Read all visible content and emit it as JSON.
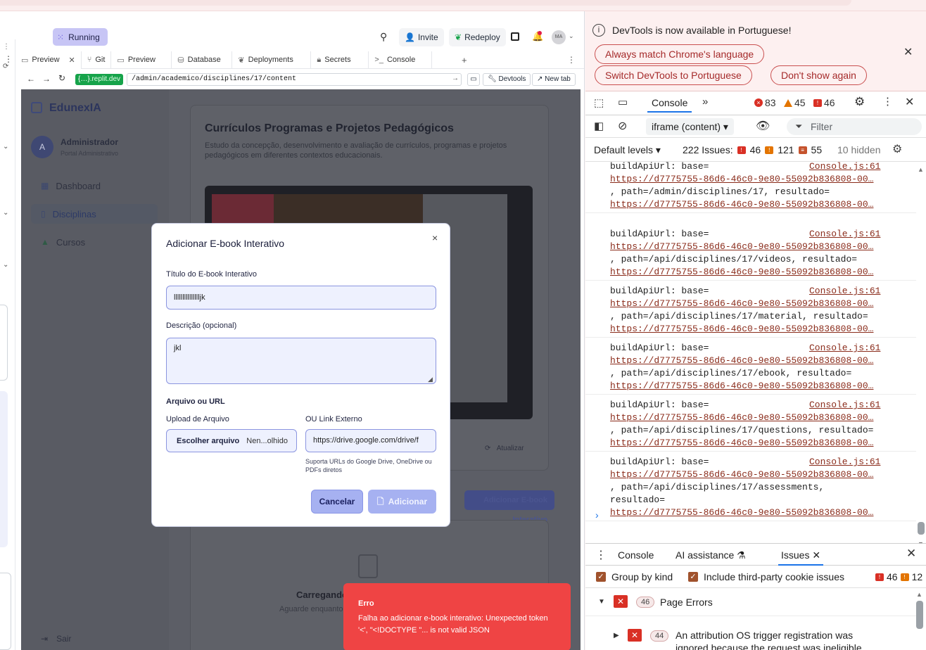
{
  "replit": {
    "status_badge": "Running",
    "invite_label": "Invite",
    "redeploy_label": "Redeploy",
    "avatar_initials": "MA",
    "tabs": [
      {
        "label": "Preview",
        "icon": "preview-icon",
        "closable": true
      },
      {
        "label": "Git",
        "icon": "git-icon"
      },
      {
        "label": "Preview",
        "icon": "preview-icon"
      },
      {
        "label": "Database",
        "icon": "database-icon"
      },
      {
        "label": "Deployments",
        "icon": "deployments-icon"
      },
      {
        "label": "Secrets",
        "icon": "lock-icon"
      },
      {
        "label": "Console",
        "icon": "terminal-icon"
      }
    ],
    "url": {
      "domain": ".replit.dev",
      "path": "/admin/academico/disciplines/17/content",
      "devtools_label": "Devtools",
      "new_tab_label": "New tab"
    }
  },
  "app": {
    "logo": "EdunexIA",
    "user": {
      "initial": "A",
      "name": "Administrador",
      "role": "Portal Administrativo"
    },
    "nav": [
      {
        "label": "Dashboard",
        "active": false
      },
      {
        "label": "Disciplinas",
        "active": true
      },
      {
        "label": "Cursos",
        "active": false
      }
    ],
    "logout_label": "Sair",
    "card_title": "Currículos Programas e Projetos Pedagógicos",
    "card_subtitle": "Estudo da concepção, desenvolvimento e avaliação de currículos, programas e projetos pedagógicos em diferentes contextos educacionais.",
    "refresh_label": "Atualizar",
    "add_ebook_label": "Adicionar E-book Interativo",
    "loading_title": "Carregando",
    "loading_sub": "Aguarde enquanto"
  },
  "modal": {
    "title": "Adicionar E-book Interativo",
    "title_label": "Título do E-book Interativo",
    "title_value": "llllllllllllllljk",
    "desc_label": "Descrição (opcional)",
    "desc_value": "jkl",
    "file_section_label": "Arquivo ou URL",
    "upload_label": "Upload de Arquivo",
    "file_button": "Escolher arquivo",
    "file_name": "Nen...olhido",
    "link_label": "OU Link Externo",
    "link_value": "https://drive.google.com/drive/f",
    "link_help": "Suporta URLs do Google Drive, OneDrive ou PDFs diretos",
    "cancel_label": "Cancelar",
    "add_label": "Adicionar"
  },
  "toast": {
    "title": "Erro",
    "message": "Falha ao adicionar e-book interativo: Unexpected token '<', \"<!DOCTYPE \"... is not valid JSON",
    "color": "#ef4444"
  },
  "devtools": {
    "info_text": "DevTools is now available in Portuguese!",
    "btn_match": "Always match Chrome's language",
    "btn_switch": "Switch DevTools to Portuguese",
    "btn_dont": "Don't show again",
    "console_tab": "Console",
    "errors": "83",
    "warnings": "45",
    "issues_count": "46",
    "context": "iframe (content)",
    "filter_placeholder": "Filter",
    "levels": "Default levels",
    "issues_label": "222 Issues:",
    "issue_err": "46",
    "issue_warn": "121",
    "issue_info": "55",
    "hidden": "10 hidden",
    "log_entries": [
      {
        "head": "buildApiUrl: base=",
        "src": "Console.js:61",
        "url1": "https://d7775755-86d6-46c0-9e80-55092b836808-00…",
        "path": ", path=/admin/disciplines/17, resultado=",
        "url2": "https://d7775755-86d6-46c0-9e80-55092b836808-00…"
      },
      {
        "head": "buildApiUrl: base=",
        "src": "Console.js:61",
        "url1": "https://d7775755-86d6-46c0-9e80-55092b836808-00…",
        "path": ", path=/api/disciplines/17/videos, resultado=",
        "url2": "https://d7775755-86d6-46c0-9e80-55092b836808-00…"
      },
      {
        "head": "buildApiUrl: base=",
        "src": "Console.js:61",
        "url1": "https://d7775755-86d6-46c0-9e80-55092b836808-00…",
        "path": ", path=/api/disciplines/17/material, resultado=",
        "url2": "https://d7775755-86d6-46c0-9e80-55092b836808-00…"
      },
      {
        "head": "buildApiUrl: base=",
        "src": "Console.js:61",
        "url1": "https://d7775755-86d6-46c0-9e80-55092b836808-00…",
        "path": ", path=/api/disciplines/17/ebook, resultado=",
        "url2": "https://d7775755-86d6-46c0-9e80-55092b836808-00…"
      },
      {
        "head": "buildApiUrl: base=",
        "src": "Console.js:61",
        "url1": "https://d7775755-86d6-46c0-9e80-55092b836808-00…",
        "path": ", path=/api/disciplines/17/questions, resultado=",
        "url2": "https://d7775755-86d6-46c0-9e80-55092b836808-00…"
      },
      {
        "head": "buildApiUrl: base=",
        "src": "Console.js:61",
        "url1": "https://d7775755-86d6-46c0-9e80-55092b836808-00…",
        "path": ", path=/api/disciplines/17/assessments,",
        "path2": "resultado=",
        "url2": "https://d7775755-86d6-46c0-9e80-55092b836808-00…"
      }
    ],
    "drawer_console": "Console",
    "drawer_ai": "AI assistance",
    "drawer_issues": "Issues",
    "group_by_kind": "Group by kind",
    "third_party": "Include third-party cookie issues",
    "opt_err": "46",
    "opt_warn": "12",
    "group_count": "46",
    "group_label": "Page Errors",
    "sub_count": "44",
    "sub_text": "An attribution OS trigger registration was ignored because the request was ineligible"
  }
}
